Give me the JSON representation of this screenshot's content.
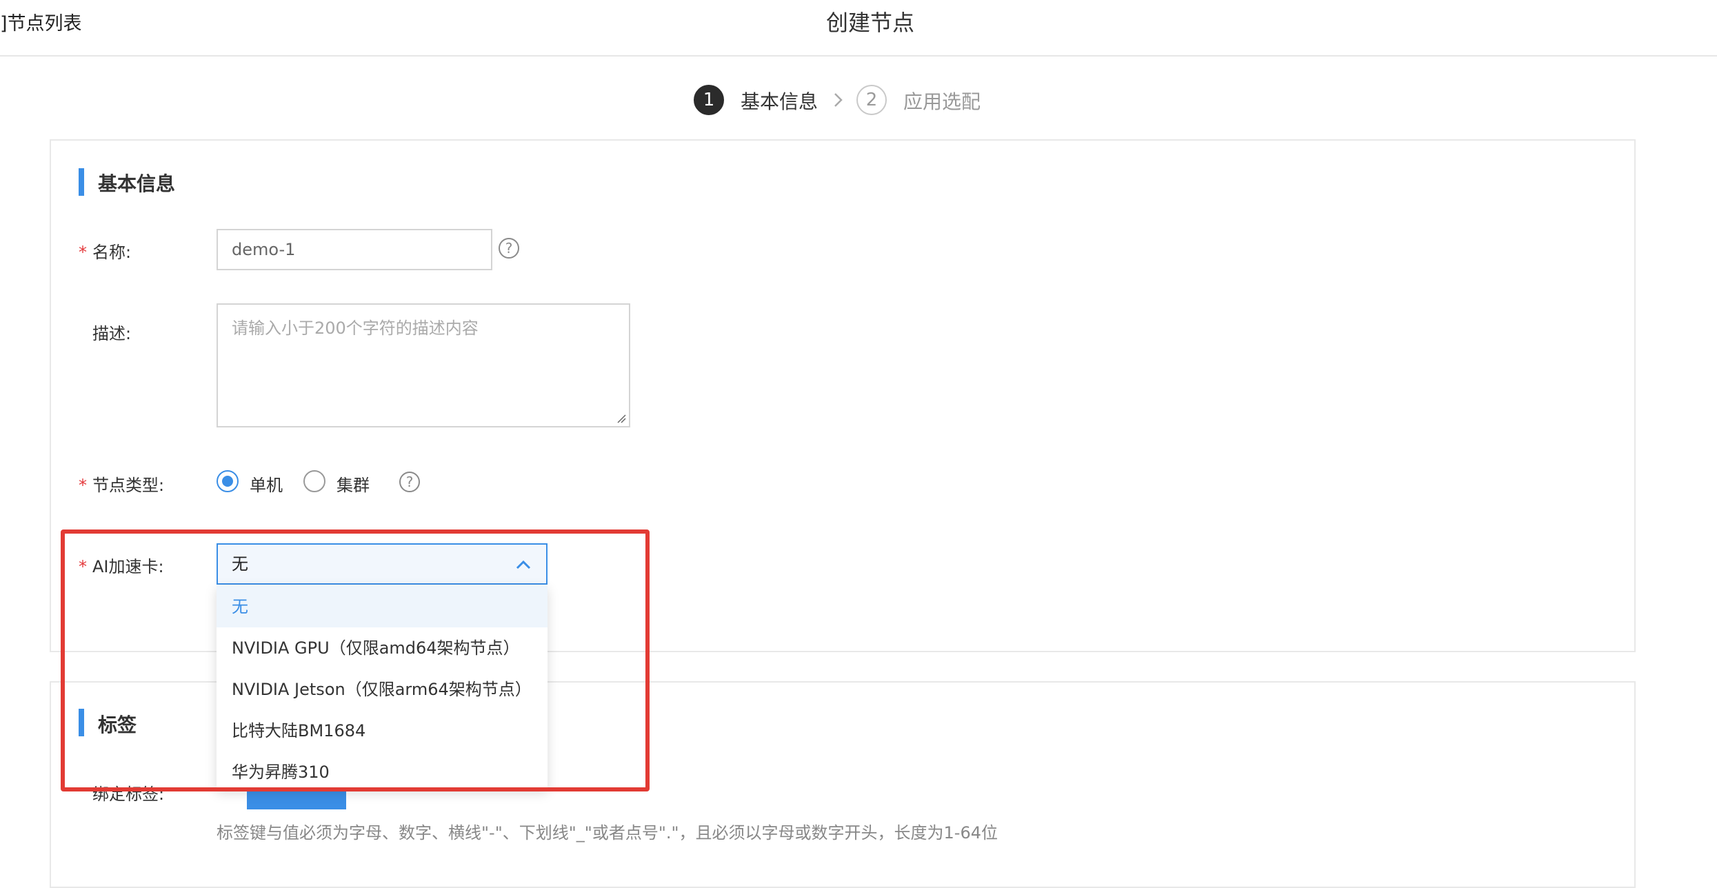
{
  "header": {
    "back_link": "]节点列表",
    "title": "创建节点"
  },
  "steps": [
    {
      "number": "1",
      "label": "基本信息"
    },
    {
      "number": "2",
      "label": "应用选配"
    }
  ],
  "basic": {
    "section_title": "基本信息",
    "name_label": "名称:",
    "name_value": "demo-1",
    "desc_label": "描述:",
    "desc_placeholder": "请输入小于200个字符的描述内容",
    "node_type_label": "节点类型:",
    "node_type_options": [
      "单机",
      "集群"
    ],
    "ai_label": "AI加速卡:",
    "ai_value": "无",
    "ai_options": [
      "无",
      "NVIDIA GPU（仅限amd64架构节点）",
      "NVIDIA Jetson（仅限arm64架构节点）",
      "比特大陆BM1684",
      "华为昇腾310"
    ]
  },
  "labels": {
    "section_title": "标签",
    "bind_label": "绑定标签:",
    "hint": "标签键与值必须为字母、数字、横线\"-\"、下划线\"_\"或者点号\".\"，且必须以字母或数字开头，长度为1-64位"
  },
  "colors": {
    "accent": "#3a8ee6",
    "required": "#e4393c",
    "highlight": "#e23b34"
  }
}
